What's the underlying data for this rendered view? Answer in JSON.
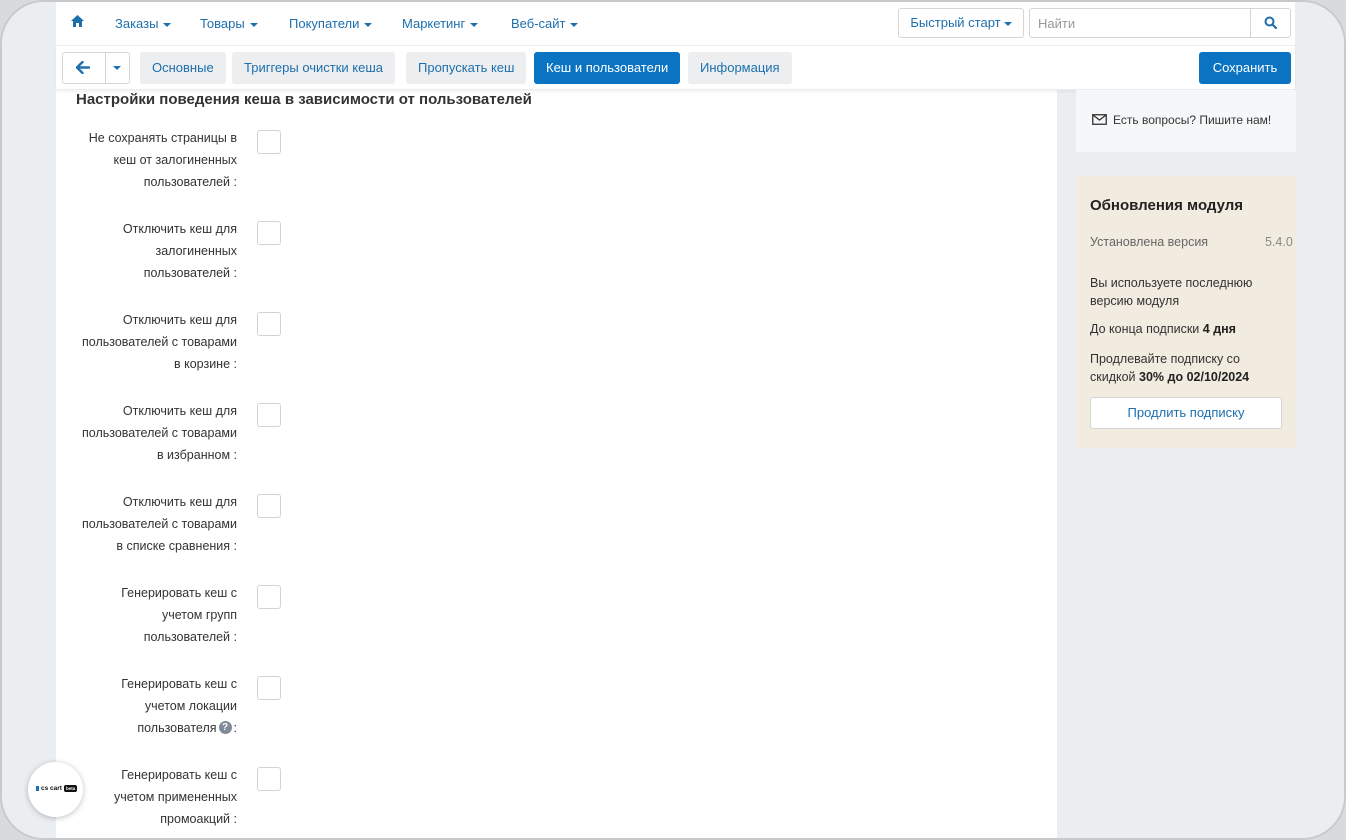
{
  "nav": {
    "items": [
      {
        "label": "Заказы"
      },
      {
        "label": "Товары"
      },
      {
        "label": "Покупатели"
      },
      {
        "label": "Маркетинг"
      },
      {
        "label": "Веб-сайт"
      }
    ],
    "quick_start": "Быстрый старт",
    "search_placeholder": "Найти"
  },
  "toolbar": {
    "tabs": [
      {
        "label": "Основные"
      },
      {
        "label": "Триггеры очистки кеша"
      },
      {
        "label": "Пропускать кеш"
      },
      {
        "label": "Кеш и пользователи"
      },
      {
        "label": "Информация"
      }
    ],
    "active_tab": "Кеш и пользователи",
    "save_label": "Сохранить"
  },
  "section": {
    "title": "Настройки поведения кеша в зависимости от пользователей",
    "settings": [
      {
        "line1": "Не сохранять страницы в",
        "line2": "кеш от залогиненных",
        "line3": "пользователей :",
        "checked": false
      },
      {
        "line1": "Отключить кеш для",
        "line2": "залогиненных",
        "line3": "пользователей :",
        "checked": false
      },
      {
        "line1": "Отключить кеш для",
        "line2": "пользователей с товарами",
        "line3": "в корзине :",
        "checked": false
      },
      {
        "line1": "Отключить кеш для",
        "line2": "пользователей с товарами",
        "line3": "в избранном :",
        "checked": false
      },
      {
        "line1": "Отключить кеш для",
        "line2": "пользователей с товарами",
        "line3": "в списке сравнения :",
        "checked": false
      },
      {
        "line1": "Генерировать кеш с",
        "line2": "учетом групп",
        "line3": "пользователей :",
        "checked": false
      },
      {
        "line1": "Генерировать кеш с",
        "line2": "учетом локации",
        "line3": "пользователя",
        "line3_suffix": ":",
        "help": "?",
        "checked": false
      },
      {
        "line1": "Генерировать кеш с",
        "line2": "учетом примененных",
        "line3": "промоакций :",
        "checked": false
      }
    ]
  },
  "sidebar": {
    "contact": "Есть вопросы? Пишите нам!",
    "update": {
      "title": "Обновления модуля",
      "installed_label": "Установлена версия",
      "installed_version": "5.4.0",
      "latest_note": "Вы используете последнюю версию модуля",
      "sub_prefix": "До конца подписки",
      "sub_days": "4 дня",
      "promo_prefix": "Продлевайте подписку со скидкой",
      "promo_bold": "30% до 02/10/2024",
      "renew_label": "Продлить подписку"
    }
  },
  "badge": {
    "logo_text": "cs cart",
    "pill": "beta"
  }
}
